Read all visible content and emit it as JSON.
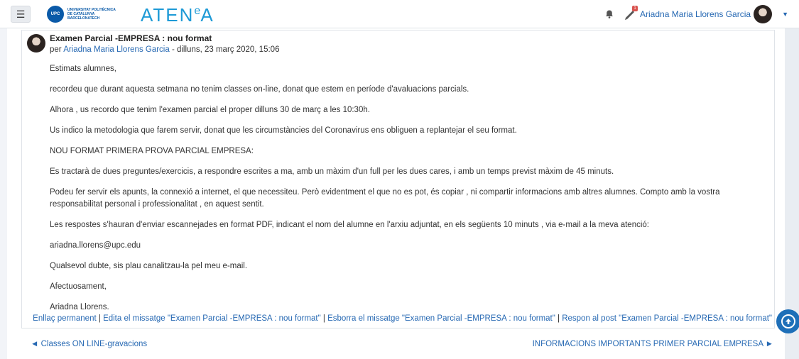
{
  "navbar": {
    "menu_icon": "hamburger-icon",
    "logo_text_line1": "Universitat Politècnica",
    "logo_text_line2": "de Catalunya",
    "logo_text_line3": "BarcelonaTech",
    "logo_circle": "UPC",
    "app_name_start": "ATEN",
    "app_name_sup": "e",
    "app_name_end": "A",
    "notification_icon": "bell-icon",
    "messages_icon": "chat-icon",
    "messages_badge": "1",
    "user_name": "Ariadna Maria Llorens Garcia",
    "user_menu_icon": "caret-down-icon"
  },
  "post": {
    "title": "Examen Parcial -EMPRESA : nou format",
    "author_prefix": "per ",
    "author": "Ariadna Maria Llorens Garcia",
    "date": " - dilluns, 23 març 2020, 15:06",
    "paragraphs": [
      "Estimats alumnes,",
      "recordeu que durant aquesta setmana no tenim classes on-line, donat que estem en període d'avaluacions parcials.",
      "Alhora , us recordo que tenim l'examen parcial el proper dilluns  30 de març a les 10:30h.",
      "Us indico la metodologia que farem servir, donat que les circumstàncies del Coronavirus ens obliguen a replantejar el seu format.",
      "NOU FORMAT PRIMERA PROVA PARCIAL EMPRESA:",
      "Es tractarà de dues preguntes/exercicis, a respondre escrites a ma, amb un màxim d'un full per les dues cares, i amb un temps previst màxim de 45 minuts.",
      "Podeu fer servir els apunts, la connexió a internet, el que necessiteu. Però evidentment el que no es pot, és copiar , ni compartir informacions amb altres alumnes. Compto amb la vostra responsabilitat personal i professionalitat , en aquest sentit.",
      "Les respostes s'hauran d'enviar escannejades en format PDF, indicant el nom del alumne en l'arxiu adjuntat, en els següents 10 minuts , via e-mail a la meva atenció:",
      "ariadna.llorens@upc.edu",
      "Qualsevol dubte, sis plau canalitzau-la pel meu e-mail.",
      "Afectuosament,",
      "Ariadna Llorens."
    ],
    "actions": {
      "permalink": "Enllaç permanent",
      "edit": "Edita el missatge \"Examen Parcial -EMPRESA : nou format\"",
      "delete": "Esborra el missatge \"Examen Parcial -EMPRESA : nou format\"",
      "reply": "Respon al post \"Examen Parcial -EMPRESA : nou format\"",
      "separator": " | "
    }
  },
  "navigation": {
    "prev_arrow": "◄",
    "prev_label": "Classes ON LINE-gravacions",
    "next_label": "INFORMACIONS IMPORTANTS PRIMER PARCIAL EMPRESA",
    "next_arrow": "►"
  },
  "scroll_top_icon": "arrow-up-circle-icon",
  "colors": {
    "link": "#2769b3",
    "brand_blue": "#0a5aa8",
    "atenea": "#1e9ad6",
    "badge": "#d9534f"
  }
}
